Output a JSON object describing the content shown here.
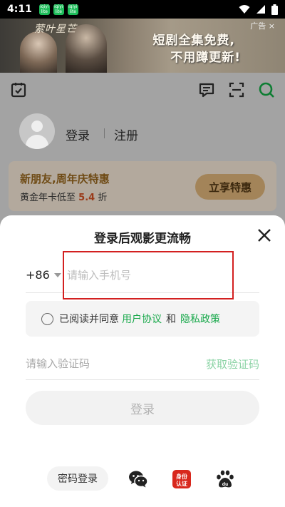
{
  "status_bar": {
    "time": "4:11",
    "notifications": [
      {
        "icon": "app-notification-icon",
        "text": "iqiyi lite"
      },
      {
        "icon": "app-notification-icon",
        "text": "iqiyi lite"
      },
      {
        "icon": "app-notification-icon",
        "text": "iqiyi lite"
      }
    ],
    "right_icons": [
      "wifi-icon",
      "signal-icon",
      "battery-icon"
    ]
  },
  "banner": {
    "logo_text": "萦叶星芒",
    "ad_label": "广告 ×",
    "headline_1": "短剧全集免费,",
    "headline_2": "不用蹲更新!"
  },
  "toolbar": {
    "icons": [
      "calendar-check-icon",
      "message-icon",
      "scan-icon",
      "search-icon"
    ]
  },
  "profile": {
    "login": "登录",
    "register": "注册"
  },
  "promo": {
    "title": "新朋友,周年庆特惠",
    "subtitle_prefix": "黄金年卡低至",
    "subtitle_value": "5.4",
    "subtitle_suffix": "折",
    "button": "立享特惠"
  },
  "sheet": {
    "title": "登录后观影更流畅",
    "country_code": "+86",
    "phone_placeholder": "请输入手机号",
    "agreement": {
      "prefix": "已阅读并同意",
      "user_agreement": "用户协议",
      "and": "和",
      "privacy_policy": "隐私政策"
    },
    "code_placeholder": "请输入验证码",
    "get_code": "获取验证码",
    "login_button": "登录",
    "password_login": "密码登录",
    "identity_badge_line1": "身份",
    "identity_badge_line2": "认证"
  },
  "colors": {
    "accent_green": "#17a84a",
    "highlight_red": "#d32020",
    "promo_gold": "#a38459"
  }
}
